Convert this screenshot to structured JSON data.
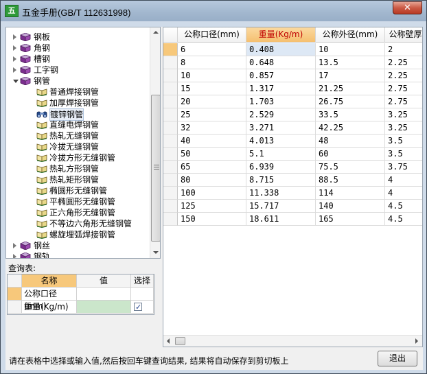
{
  "window": {
    "title": "五金手册(GB/T 112631998)",
    "close_glyph": "✕"
  },
  "tree": {
    "categories": [
      {
        "label": "钢板",
        "expanded": false
      },
      {
        "label": "角钢",
        "expanded": false
      },
      {
        "label": "槽钢",
        "expanded": false
      },
      {
        "label": "工字钢",
        "expanded": false
      },
      {
        "label": "钢管",
        "expanded": true
      }
    ],
    "children": [
      "普通焊接钢管",
      "加厚焊接钢管",
      "镀锌钢管",
      "直缝电焊钢管",
      "热轧无缝钢管",
      "冷拔无缝钢管",
      "冷拔方形无缝钢管",
      "热轧方形钢管",
      "热轧矩形钢管",
      "椭圆形无缝钢管",
      "平椭圆形无缝钢管",
      "正六角形无缝钢管",
      "不等边六角形无缝钢管",
      "螺旋埋弧焊接钢管"
    ],
    "selected_child": "镀锌钢管",
    "after_categories": [
      {
        "label": "钢丝",
        "expanded": false
      },
      {
        "label": "钢轨",
        "expanded": false
      }
    ]
  },
  "query": {
    "label": "查询表:",
    "headers": [
      "名称",
      "值",
      "选择"
    ],
    "rows": [
      {
        "name": "公称口径(mm)",
        "value": "",
        "checked": false
      },
      {
        "name": "重量(Kg/m)",
        "value": "",
        "checked": true
      }
    ]
  },
  "table": {
    "headers": [
      "公称口径(mm)",
      "重量(Kg/m)",
      "公称外径(mm)",
      "公称壁厚"
    ],
    "selected_header": 1,
    "rows": [
      [
        "6",
        "0.408",
        "10",
        "2"
      ],
      [
        "8",
        "0.648",
        "13.5",
        "2.25"
      ],
      [
        "10",
        "0.857",
        "17",
        "2.25"
      ],
      [
        "15",
        "1.317",
        "21.25",
        "2.75"
      ],
      [
        "20",
        "1.703",
        "26.75",
        "2.75"
      ],
      [
        "25",
        "2.529",
        "33.5",
        "3.25"
      ],
      [
        "32",
        "3.271",
        "42.25",
        "3.25"
      ],
      [
        "40",
        "4.013",
        "48",
        "3.5"
      ],
      [
        "50",
        "5.1",
        "60",
        "3.5"
      ],
      [
        "65",
        "6.939",
        "75.5",
        "3.75"
      ],
      [
        "80",
        "8.715",
        "88.5",
        "4"
      ],
      [
        "100",
        "11.338",
        "114",
        "4"
      ],
      [
        "125",
        "15.717",
        "140",
        "4.5"
      ],
      [
        "150",
        "18.611",
        "165",
        "4.5"
      ]
    ]
  },
  "status": {
    "text": "请在表格中选择或输入值,然后按回车键查询结果, 结果将自动保存到剪切板上"
  },
  "buttons": {
    "exit": "退出"
  },
  "colors": {
    "selection_orange": "#f7c87b",
    "selected_cell": "#dde8f5",
    "query_value_green": "#cbe6cb",
    "titlebar": "#a3b8cf",
    "accent_red": "#c00000"
  },
  "icons": {
    "category": "purple-book-icon",
    "child": "open-book-icon",
    "selected_child": "binoculars-icon",
    "app": "app-logo-icon"
  }
}
